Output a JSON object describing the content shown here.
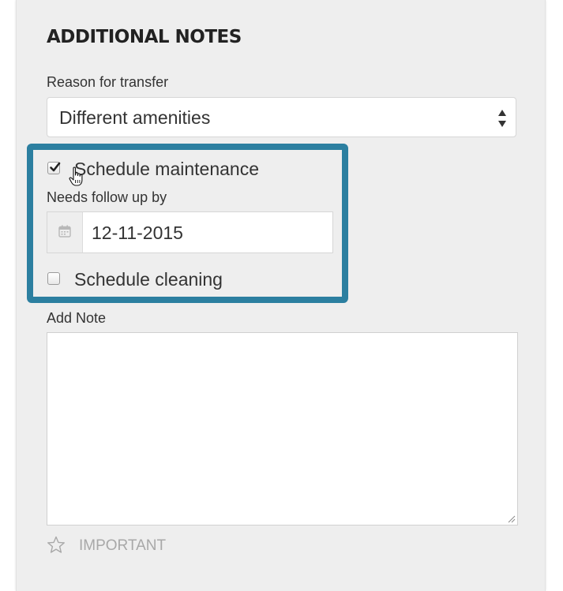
{
  "section": {
    "title": "ADDITIONAL NOTES"
  },
  "reason": {
    "label": "Reason for transfer",
    "selected": "Different amenities"
  },
  "maintenance": {
    "label": "Schedule maintenance",
    "checked": true
  },
  "followup": {
    "label": "Needs follow up by",
    "date": "12-11-2015"
  },
  "cleaning": {
    "label": "Schedule cleaning",
    "checked": false
  },
  "note": {
    "label": "Add Note",
    "value": ""
  },
  "important": {
    "label": "IMPORTANT"
  },
  "colors": {
    "panel_bg": "#eeeeee",
    "highlight_border": "#2c7fa0",
    "muted_text": "#a8a8a8",
    "text": "#333333"
  },
  "icons": [
    "sort-arrows-icon",
    "checkmark-icon",
    "calendar-icon",
    "resize-grip-icon",
    "star-outline-icon",
    "hand-pointer-icon"
  ]
}
